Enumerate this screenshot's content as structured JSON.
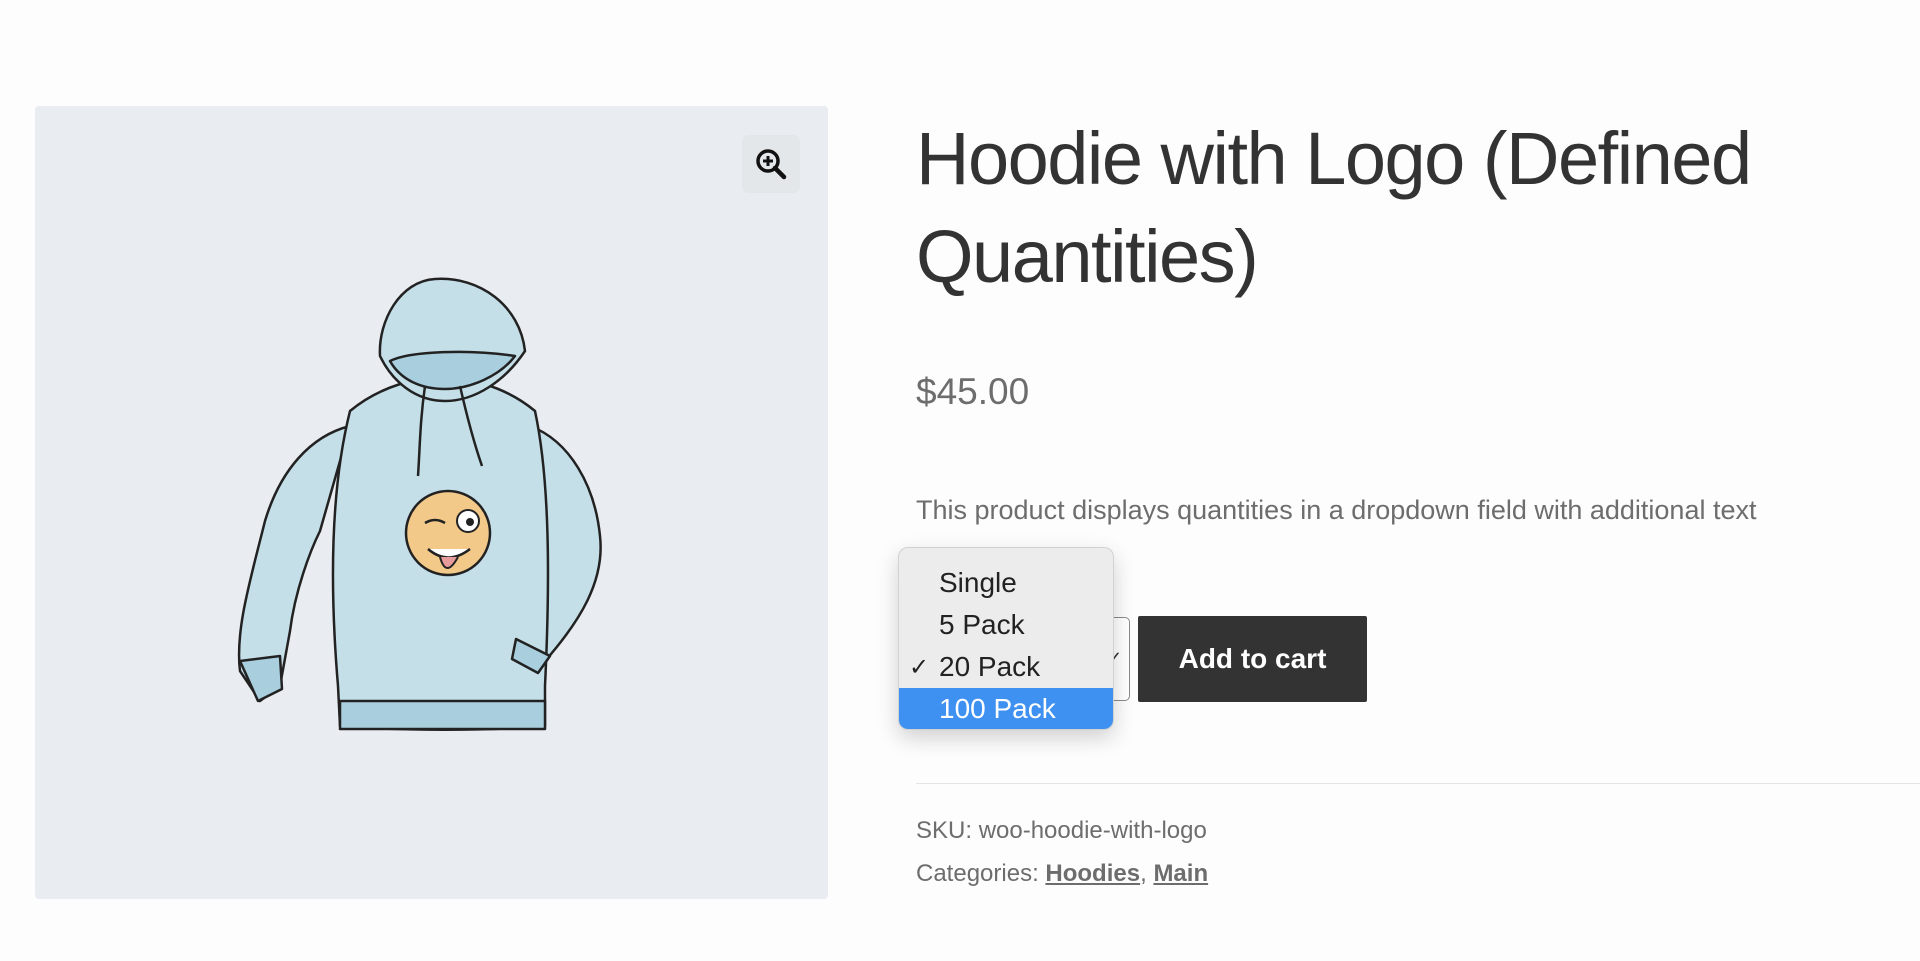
{
  "product": {
    "title": "Hoodie with Logo (Defined Quantities)",
    "price": "$45.00",
    "description": "This product displays quantities in a dropdown field with additional text",
    "add_to_cart_label": "Add to cart"
  },
  "quantity_dropdown": {
    "selected": "20 Pack",
    "highlighted": "100 Pack",
    "options": [
      {
        "label": "Single"
      },
      {
        "label": "5 Pack"
      },
      {
        "label": "20 Pack",
        "check": "✓"
      },
      {
        "label": "100 Pack"
      }
    ]
  },
  "meta": {
    "sku_label": "SKU:",
    "sku_value": "woo-hoodie-with-logo",
    "categories_label": "Categories:",
    "categories": [
      "Hoodies",
      "Main"
    ],
    "category_separator": ","
  },
  "colors": {
    "button_bg": "#333333",
    "highlight": "#3e91f0",
    "gallery_bg": "#e9edf1",
    "hoodie_fill": "#c5dfe9",
    "emoji_fill": "#f2c989"
  },
  "icons": {
    "zoom": "zoom-in-icon",
    "chevron": "chevron-down-icon",
    "check": "checkmark-icon"
  }
}
